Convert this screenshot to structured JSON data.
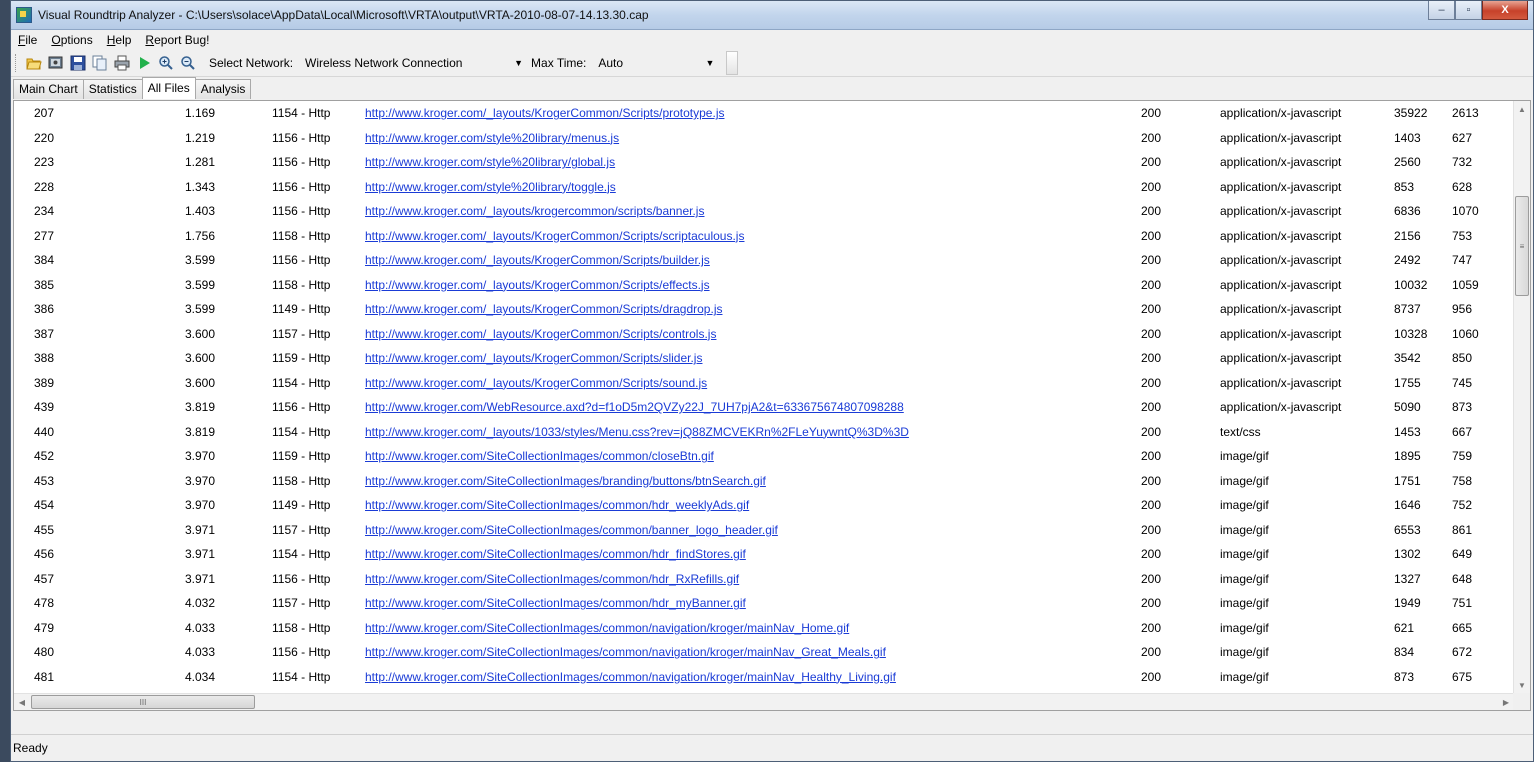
{
  "window": {
    "title": "Visual Roundtrip Analyzer - C:\\Users\\solace\\AppData\\Local\\Microsoft\\VRTA\\output\\VRTA-2010-08-07-14.13.30.cap",
    "minimize_glyph": "–",
    "maximize_glyph": "▫",
    "close_glyph": "X"
  },
  "menu": [
    "File",
    "Options",
    "Help",
    "Report Bug!"
  ],
  "toolbar": {
    "icons": [
      "open-folder-icon",
      "capture-icon",
      "save-icon",
      "copy-icon",
      "print-icon",
      "play-icon",
      "zoom-in-icon",
      "zoom-out-icon"
    ],
    "network_label": "Select Network:",
    "network_value": "Wireless Network Connection",
    "maxtime_label": "Max Time:",
    "maxtime_value": "Auto",
    "dropdown_glyph": "▼"
  },
  "tabs": [
    "Main Chart",
    "Statistics",
    "All Files",
    "Analysis"
  ],
  "active_tab": "All Files",
  "rows": [
    [
      "207",
      "1.169",
      "1154 - Http",
      "http://www.kroger.com/_layouts/KrogerCommon/Scripts/prototype.js",
      "200",
      "application/x-javascript",
      "35922",
      "2613"
    ],
    [
      "220",
      "1.219",
      "1156 - Http",
      "http://www.kroger.com/style%20library/menus.js",
      "200",
      "application/x-javascript",
      "1403",
      "627"
    ],
    [
      "223",
      "1.281",
      "1156 - Http",
      "http://www.kroger.com/style%20library/global.js",
      "200",
      "application/x-javascript",
      "2560",
      "732"
    ],
    [
      "228",
      "1.343",
      "1156 - Http",
      "http://www.kroger.com/style%20library/toggle.js",
      "200",
      "application/x-javascript",
      "853",
      "628"
    ],
    [
      "234",
      "1.403",
      "1156 - Http",
      "http://www.kroger.com/_layouts/krogercommon/scripts/banner.js",
      "200",
      "application/x-javascript",
      "6836",
      "1070"
    ],
    [
      "277",
      "1.756",
      "1158 - Http",
      "http://www.kroger.com/_layouts/KrogerCommon/Scripts/scriptaculous.js",
      "200",
      "application/x-javascript",
      "2156",
      "753"
    ],
    [
      "384",
      "3.599",
      "1156 - Http",
      "http://www.kroger.com/_layouts/KrogerCommon/Scripts/builder.js",
      "200",
      "application/x-javascript",
      "2492",
      "747"
    ],
    [
      "385",
      "3.599",
      "1158 - Http",
      "http://www.kroger.com/_layouts/KrogerCommon/Scripts/effects.js",
      "200",
      "application/x-javascript",
      "10032",
      "1059"
    ],
    [
      "386",
      "3.599",
      "1149 - Http",
      "http://www.kroger.com/_layouts/KrogerCommon/Scripts/dragdrop.js",
      "200",
      "application/x-javascript",
      "8737",
      "956"
    ],
    [
      "387",
      "3.600",
      "1157 - Http",
      "http://www.kroger.com/_layouts/KrogerCommon/Scripts/controls.js",
      "200",
      "application/x-javascript",
      "10328",
      "1060"
    ],
    [
      "388",
      "3.600",
      "1159 - Http",
      "http://www.kroger.com/_layouts/KrogerCommon/Scripts/slider.js",
      "200",
      "application/x-javascript",
      "3542",
      "850"
    ],
    [
      "389",
      "3.600",
      "1154 - Http",
      "http://www.kroger.com/_layouts/KrogerCommon/Scripts/sound.js",
      "200",
      "application/x-javascript",
      "1755",
      "745"
    ],
    [
      "439",
      "3.819",
      "1156 - Http",
      "http://www.kroger.com/WebResource.axd?d=f1oD5m2QVZy22J_7UH7pjA2&t=633675674807098288",
      "200",
      "application/x-javascript",
      "5090",
      "873"
    ],
    [
      "440",
      "3.819",
      "1154 - Http",
      "http://www.kroger.com/_layouts/1033/styles/Menu.css?rev=jQ88ZMCVEKRn%2FLeYuywntQ%3D%3D",
      "200",
      "text/css",
      "1453",
      "667"
    ],
    [
      "452",
      "3.970",
      "1159 - Http",
      "http://www.kroger.com/SiteCollectionImages/common/closeBtn.gif",
      "200",
      "image/gif",
      "1895",
      "759"
    ],
    [
      "453",
      "3.970",
      "1158 - Http",
      "http://www.kroger.com/SiteCollectionImages/branding/buttons/btnSearch.gif",
      "200",
      "image/gif",
      "1751",
      "758"
    ],
    [
      "454",
      "3.970",
      "1149 - Http",
      "http://www.kroger.com/SiteCollectionImages/common/hdr_weeklyAds.gif",
      "200",
      "image/gif",
      "1646",
      "752"
    ],
    [
      "455",
      "3.971",
      "1157 - Http",
      "http://www.kroger.com/SiteCollectionImages/common/banner_logo_header.gif",
      "200",
      "image/gif",
      "6553",
      "861"
    ],
    [
      "456",
      "3.971",
      "1154 - Http",
      "http://www.kroger.com/SiteCollectionImages/common/hdr_findStores.gif",
      "200",
      "image/gif",
      "1302",
      "649"
    ],
    [
      "457",
      "3.971",
      "1156 - Http",
      "http://www.kroger.com/SiteCollectionImages/common/hdr_RxRefills.gif",
      "200",
      "image/gif",
      "1327",
      "648"
    ],
    [
      "478",
      "4.032",
      "1157 - Http",
      "http://www.kroger.com/SiteCollectionImages/common/hdr_myBanner.gif",
      "200",
      "image/gif",
      "1949",
      "751"
    ],
    [
      "479",
      "4.033",
      "1158 - Http",
      "http://www.kroger.com/SiteCollectionImages/common/navigation/kroger/mainNav_Home.gif",
      "200",
      "image/gif",
      "621",
      "665"
    ],
    [
      "480",
      "4.033",
      "1156 - Http",
      "http://www.kroger.com/SiteCollectionImages/common/navigation/kroger/mainNav_Great_Meals.gif",
      "200",
      "image/gif",
      "834",
      "672"
    ],
    [
      "481",
      "4.034",
      "1154 - Http",
      "http://www.kroger.com/SiteCollectionImages/common/navigation/kroger/mainNav_Healthy_Living.gif",
      "200",
      "image/gif",
      "873",
      "675"
    ]
  ],
  "scrollbars": {
    "up_glyph": "▲",
    "down_glyph": "▼",
    "left_glyph": "◀",
    "right_glyph": "▶",
    "v_grip": "≡",
    "h_grip": "III"
  },
  "status": "Ready",
  "colors": {
    "link": "#1a3bd6",
    "title_bar": "#c2d5ec",
    "close_button": "#c7412a"
  }
}
